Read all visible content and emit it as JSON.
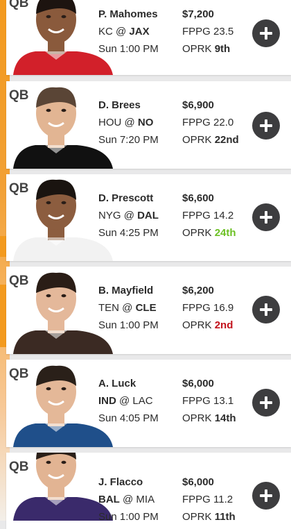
{
  "players": [
    {
      "position": "QB",
      "name": "P. Mahomes",
      "team": "KC",
      "opponent": "JAX",
      "home_team": "JAX",
      "time": "Sun 1:00 PM",
      "salary": "$7,200",
      "fppg_label": "FPPG",
      "fppg": "23.5",
      "oprk_label": "OPRK",
      "oprk": "9th",
      "oprk_color": "#2b2b2b",
      "jersey_color": "#d2202a",
      "skin": "#8a5a3c",
      "hair": "#1d1410"
    },
    {
      "position": "QB",
      "name": "D. Brees",
      "team": "HOU",
      "opponent": "NO",
      "home_team": "NO",
      "time": "Sun 7:20 PM",
      "salary": "$6,900",
      "fppg_label": "FPPG",
      "fppg": "22.0",
      "oprk_label": "OPRK",
      "oprk": "22nd",
      "oprk_color": "#2b2b2b",
      "jersey_color": "#111111",
      "skin": "#e2b593",
      "hair": "#5a4536"
    },
    {
      "position": "QB",
      "name": "D. Prescott",
      "team": "NYG",
      "opponent": "DAL",
      "home_team": "DAL",
      "time": "Sun 4:25 PM",
      "salary": "$6,600",
      "fppg_label": "FPPG",
      "fppg": "14.2",
      "oprk_label": "OPRK",
      "oprk": "24th",
      "oprk_color": "#6cc024",
      "jersey_color": "#f2f2f2",
      "skin": "#8c5d3f",
      "hair": "#1a1410"
    },
    {
      "position": "QB",
      "name": "B. Mayfield",
      "team": "TEN",
      "opponent": "CLE",
      "home_team": "CLE",
      "time": "Sun 1:00 PM",
      "salary": "$6,200",
      "fppg_label": "FPPG",
      "fppg": "16.9",
      "oprk_label": "OPRK",
      "oprk": "2nd",
      "oprk_color": "#c2121c",
      "jersey_color": "#3b2a23",
      "skin": "#e4b89a",
      "hair": "#2a1d16"
    },
    {
      "position": "QB",
      "name": "A. Luck",
      "team": "IND",
      "opponent": "LAC",
      "home_team": "IND",
      "time": "Sun 4:05 PM",
      "salary": "$6,000",
      "fppg_label": "FPPG",
      "fppg": "13.1",
      "oprk_label": "OPRK",
      "oprk": "14th",
      "oprk_color": "#2b2b2b",
      "jersey_color": "#1f4f8a",
      "skin": "#e4b898",
      "hair": "#2a2019"
    },
    {
      "position": "QB",
      "name": "J. Flacco",
      "team": "BAL",
      "opponent": "MIA",
      "home_team": "BAL",
      "time": "Sun 1:00 PM",
      "salary": "$6,000",
      "fppg_label": "FPPG",
      "fppg": "11.2",
      "oprk_label": "OPRK",
      "oprk": "11th",
      "oprk_color": "#2b2b2b",
      "jersey_color": "#3a2a6b",
      "skin": "#e2b493",
      "hair": "#2a1f18"
    }
  ],
  "at_symbol": "@",
  "add_icon": "plus-circle-icon",
  "accent_color": "#f39a1e"
}
